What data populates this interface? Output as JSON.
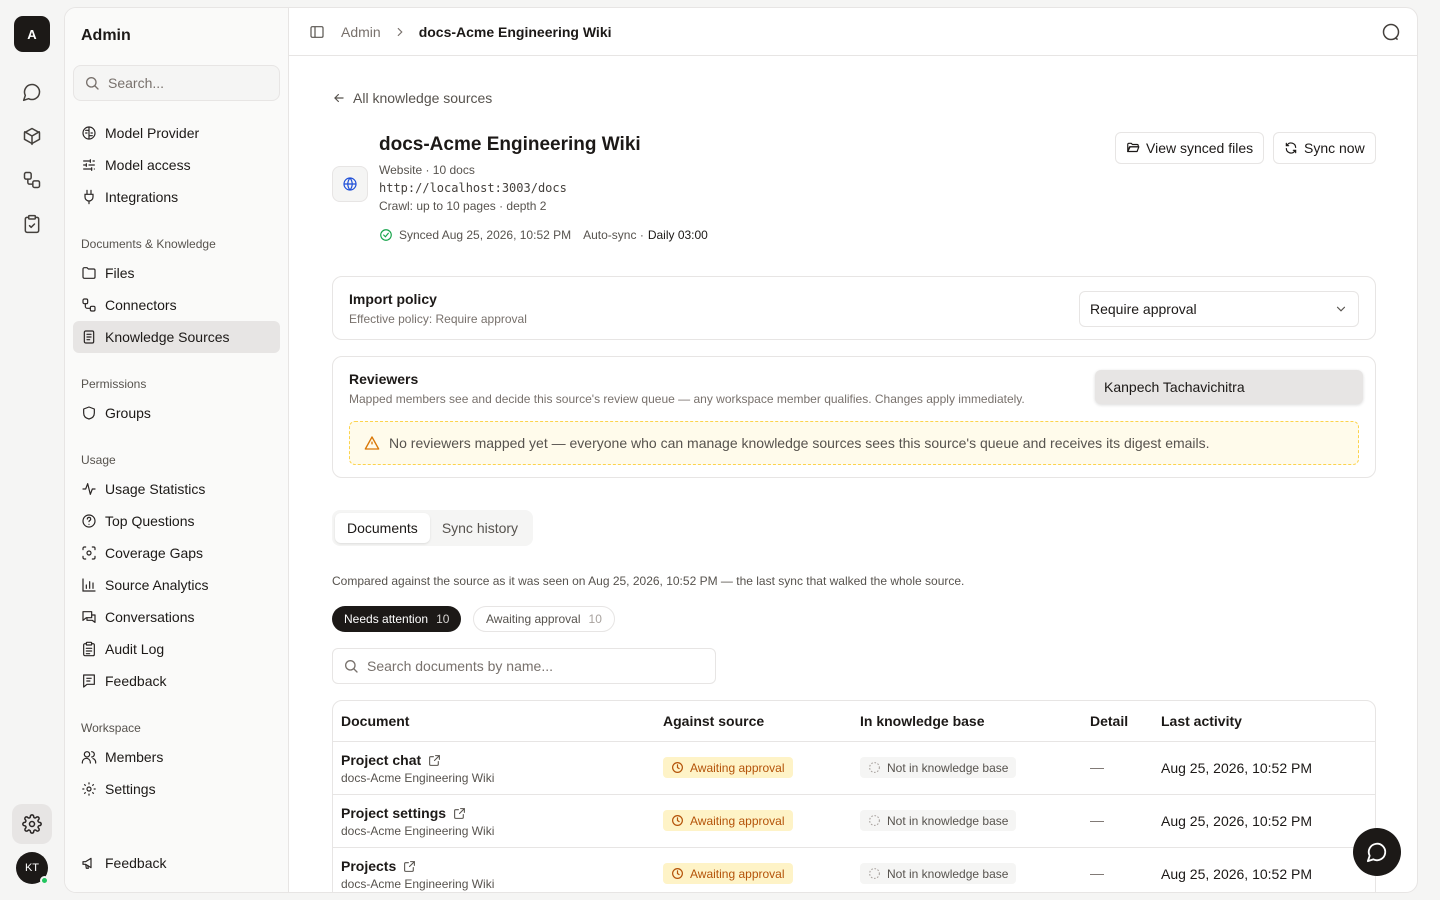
{
  "rail": {
    "logo": "A",
    "avatar": "KT"
  },
  "sidebar": {
    "title": "Admin",
    "search_placeholder": "Search...",
    "top_items": [
      {
        "label": "Model Provider",
        "icon": "brain-icon"
      },
      {
        "label": "Model access",
        "icon": "sliders-icon"
      },
      {
        "label": "Integrations",
        "icon": "plug-icon"
      }
    ],
    "groups": [
      {
        "label": "Documents & Knowledge",
        "items": [
          {
            "label": "Files",
            "icon": "folder-icon"
          },
          {
            "label": "Connectors",
            "icon": "connector-icon"
          },
          {
            "label": "Knowledge Sources",
            "icon": "book-icon",
            "active": true
          }
        ]
      },
      {
        "label": "Permissions",
        "items": [
          {
            "label": "Groups",
            "icon": "shield-icon"
          }
        ]
      },
      {
        "label": "Usage",
        "items": [
          {
            "label": "Usage Statistics",
            "icon": "activity-icon"
          },
          {
            "label": "Top Questions",
            "icon": "question-icon"
          },
          {
            "label": "Coverage Gaps",
            "icon": "scan-icon"
          },
          {
            "label": "Source Analytics",
            "icon": "bar-chart-icon"
          },
          {
            "label": "Conversations",
            "icon": "messages-icon"
          },
          {
            "label": "Audit Log",
            "icon": "clipboard-icon"
          },
          {
            "label": "Feedback",
            "icon": "message-square-icon"
          }
        ]
      },
      {
        "label": "Workspace",
        "items": [
          {
            "label": "Members",
            "icon": "users-icon"
          },
          {
            "label": "Settings",
            "icon": "gear-icon"
          }
        ]
      }
    ],
    "footer_feedback": "Feedback"
  },
  "topbar": {
    "crumb_root": "Admin",
    "crumb_current": "docs-Acme Engineering Wiki"
  },
  "source": {
    "back_label": "All knowledge sources",
    "title": "docs-Acme Engineering Wiki",
    "meta": "Website · 10 docs",
    "url": "http://localhost:3003/docs",
    "crawl": "Crawl: up to 10 pages · depth 2",
    "synced": "Synced Aug 25, 2026, 10:52 PM",
    "autosync_label": "Auto-sync ·",
    "autosync_value": "Daily 03:00",
    "view_synced_label": "View synced files",
    "sync_now_label": "Sync now"
  },
  "import_policy": {
    "title": "Import policy",
    "subtitle": "Effective policy: Require approval",
    "selected": "Require approval"
  },
  "reviewers": {
    "title": "Reviewers",
    "subtitle": "Mapped members see and decide this source's review queue — any workspace member qualifies. Changes apply immediately.",
    "selected_member": "Kanpech Tachavichitra",
    "warning": "No reviewers mapped yet — everyone who can manage knowledge sources sees this source's queue and receives its digest emails."
  },
  "tabs": [
    "Documents",
    "Sync history"
  ],
  "compared_note": "Compared against the source as it was seen on Aug 25, 2026, 10:52 PM — the last sync that walked the whole source.",
  "filters": [
    {
      "label": "Needs attention",
      "count": "10"
    },
    {
      "label": "Awaiting approval",
      "count": "10"
    }
  ],
  "doc_search_placeholder": "Search documents by name...",
  "table": {
    "columns": [
      "Document",
      "Against source",
      "In knowledge base",
      "Detail",
      "Last activity"
    ],
    "rows": [
      {
        "name": "Project chat",
        "source": "docs-Acme Engineering Wiki",
        "against": "Awaiting approval",
        "kb": "Not in knowledge base",
        "detail": "—",
        "last": "Aug 25, 2026, 10:52 PM"
      },
      {
        "name": "Project settings",
        "source": "docs-Acme Engineering Wiki",
        "against": "Awaiting approval",
        "kb": "Not in knowledge base",
        "detail": "—",
        "last": "Aug 25, 2026, 10:52 PM"
      },
      {
        "name": "Projects",
        "source": "docs-Acme Engineering Wiki",
        "against": "Awaiting approval",
        "kb": "Not in knowledge base",
        "detail": "—",
        "last": "Aug 25, 2026, 10:52 PM"
      }
    ]
  },
  "colors": {
    "accent_dark": "#1c1917",
    "warning_bg": "#fffbeb",
    "amber_badge": "#fef3c7",
    "success": "#16a34a"
  }
}
